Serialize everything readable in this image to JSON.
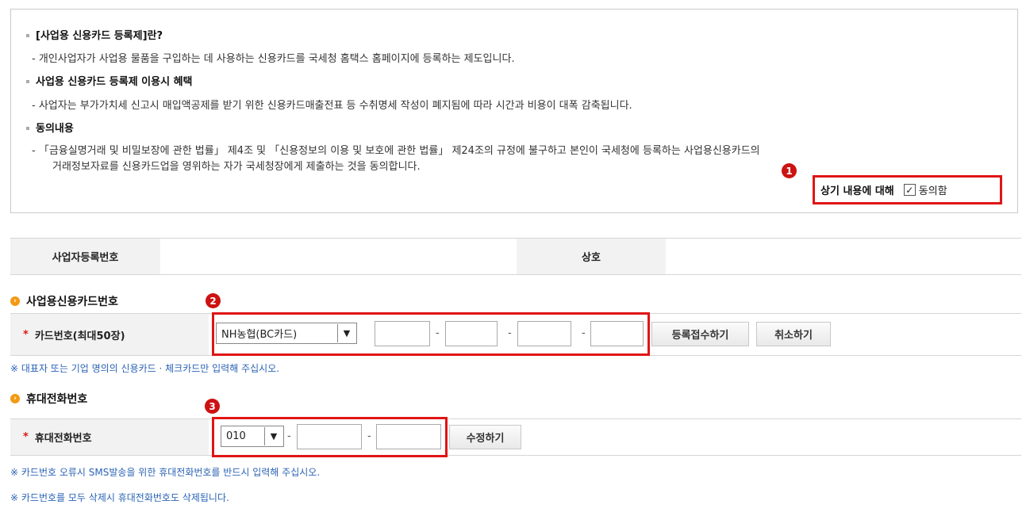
{
  "intro": {
    "h1": "[사업용 신용카드 등록제]란?",
    "p1": "- 개인사업자가 사업용 물품을 구입하는 데 사용하는 신용카드를 국세청 홈택스 홈페이지에 등록하는 제도입니다.",
    "h2": "사업용 신용카드 등록제 이용시 혜택",
    "p2": "- 사업자는 부가가치세 신고시 매입액공제를 받기 위한 신용카드매출전표 등 수취명세 작성이 폐지됨에 따라 시간과 비용이 대폭 감축됩니다.",
    "h3": "동의내용",
    "p3a": "- 「금융실명거래 및 비밀보장에 관한 법률」 제4조 및 「신용정보의 이용 및 보호에 관한 법률」 제24조의 규정에 불구하고 본인이 국세청에 등록하는 사업용신용카드의",
    "p3b": "거래정보자료를 신용카드업을 영위하는 자가 국세청장에게 제출하는 것을 동의합니다."
  },
  "agree": {
    "label": "상기 내용에 대해",
    "check_label": "동의함",
    "checked": true
  },
  "badges": {
    "b1": "1",
    "b2": "2",
    "b3": "3"
  },
  "business": {
    "regno_label": "사업자등록번호",
    "regno_value": "",
    "name_label": "상호",
    "name_value": ""
  },
  "card": {
    "section_title": "사업용신용카드번호",
    "field_label": "카드번호(최대50장)",
    "required_mark": "*",
    "company_selected": "NH농협(BC카드)",
    "num1": "",
    "num2": "",
    "num3": "",
    "num4": "",
    "dash": "-",
    "register_button": "등록접수하기",
    "cancel_button": "취소하기",
    "note": "※ 대표자 또는 기업 명의의 신용카드 · 체크카드만 입력해 주십시오."
  },
  "phone": {
    "section_title": "휴대전화번호",
    "field_label": "휴대전화번호",
    "required_mark": "*",
    "prefix_selected": "010",
    "mid": "",
    "last": "",
    "dash": "-",
    "edit_button": "수정하기",
    "note1": "※ 카드번호 오류시 SMS발송을 위한 휴대전화번호를 반드시 입력해 주십시오.",
    "note2": "※ 카드번호를 모두 삭제시 휴대전화번호도 삭제됩니다."
  },
  "icons": {
    "section": "orange-circle-arrow-icon",
    "checkbox": "check-icon",
    "dropdown": "chevron-down-icon"
  },
  "colors": {
    "highlight": "#e01515",
    "badge": "#cc1212",
    "note": "#2b63b5",
    "section_icon": "#f39a12"
  }
}
